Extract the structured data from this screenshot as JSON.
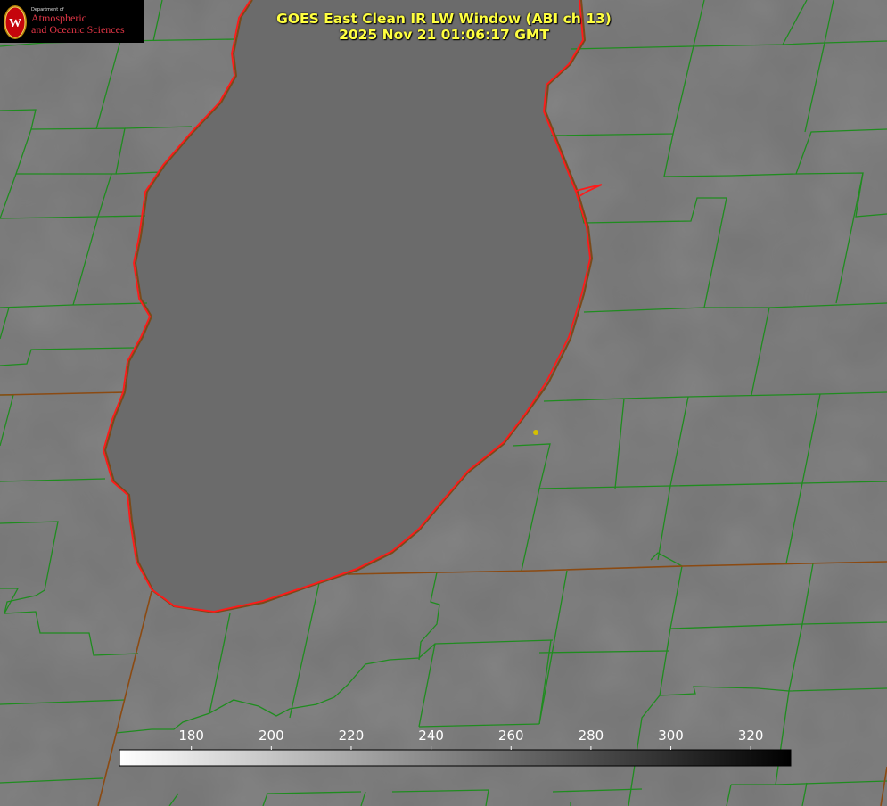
{
  "logo": {
    "department_line": "Department of",
    "name_line1": "Atmospheric",
    "name_line2": "and Oceanic Sciences",
    "seal_letter": "W",
    "accent_color": "#c5050c"
  },
  "title": {
    "line1": "GOES East Clean IR LW Window (ABI ch 13)",
    "line2": "2025 Nov 21 01:06:17 GMT",
    "color": "#ffff40"
  },
  "colorbar": {
    "min": 162,
    "max": 330,
    "ticks": [
      180,
      200,
      220,
      240,
      260,
      280,
      300,
      320
    ],
    "gradient": [
      "#ffffff",
      "#000000"
    ]
  },
  "map_colors": {
    "background": "#747474",
    "lake": "#6a6a6a",
    "county_lines": "#1e8c1e",
    "state_lines": "#8a4a10",
    "coastline": "#ff1a1a",
    "marker": "#d4c000"
  }
}
